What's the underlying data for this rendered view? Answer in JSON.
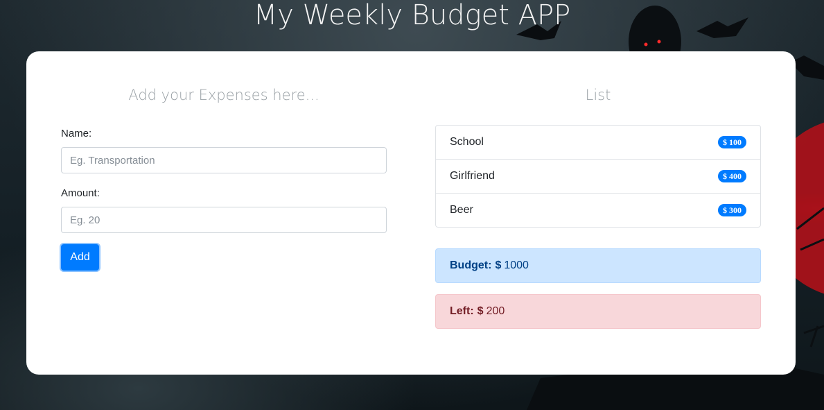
{
  "app": {
    "title": "My Weekly Budget APP"
  },
  "form": {
    "heading": "Add your Expenses here...",
    "name_label": "Name:",
    "name_placeholder": "Eg. Transportation",
    "amount_label": "Amount:",
    "amount_placeholder": "Eg. 20",
    "add_label": "Add"
  },
  "list": {
    "heading": "List",
    "items": [
      {
        "name": "School",
        "amount": "$ 100"
      },
      {
        "name": "Girlfriend",
        "amount": "$ 400"
      },
      {
        "name": "Beer",
        "amount": "$ 300"
      }
    ]
  },
  "summary": {
    "budget_label": "Budget:",
    "budget_currency": "$",
    "budget_value": "1000",
    "left_label": "Left:",
    "left_currency": "$",
    "left_value": "200"
  },
  "colors": {
    "primary": "#007bff",
    "budget_bg": "#cce5ff",
    "left_bg": "#f8d7da",
    "moon_red": "#b8141a"
  }
}
